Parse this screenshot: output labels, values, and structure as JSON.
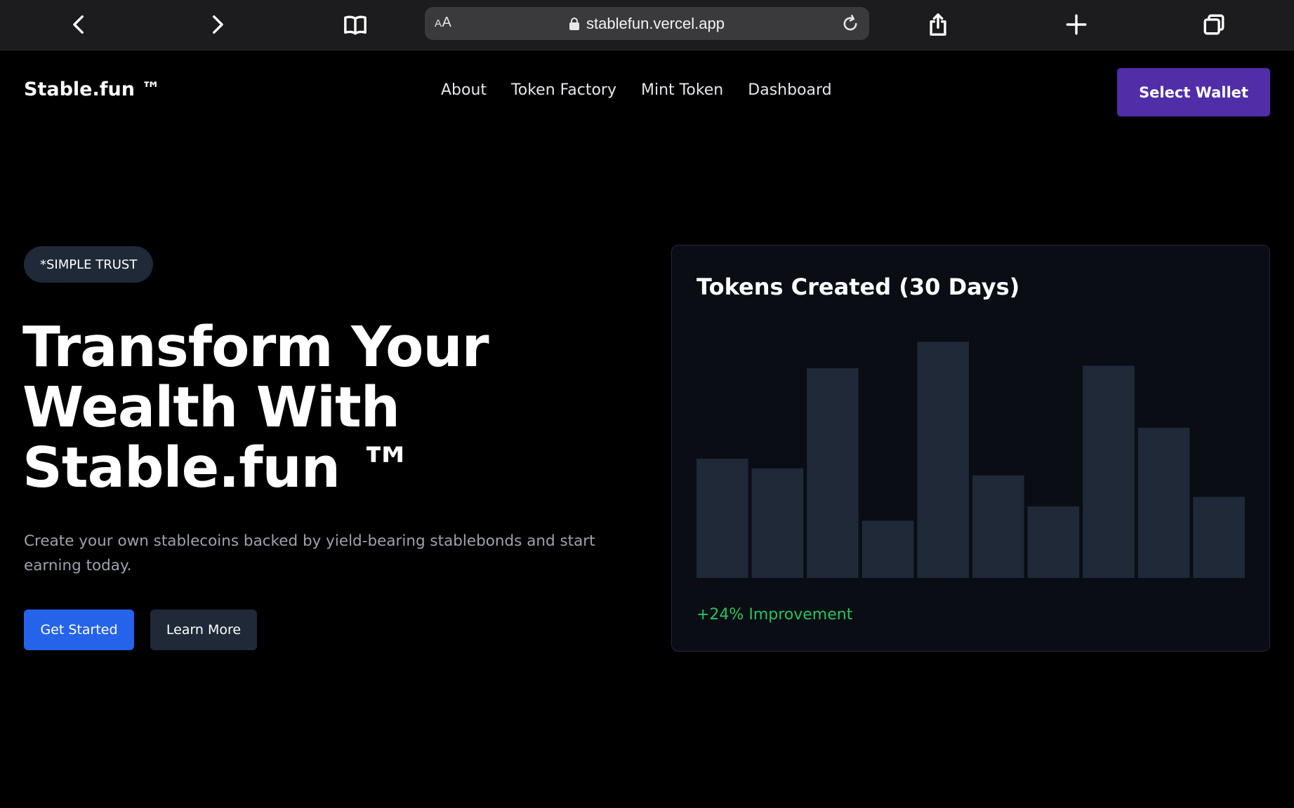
{
  "browser": {
    "url": "stablefun.vercel.app",
    "reader_label_small": "A",
    "reader_label_large": "A"
  },
  "site": {
    "logo": "Stable.fun ™",
    "nav": [
      "About",
      "Token Factory",
      "Mint Token",
      "Dashboard"
    ],
    "wallet_button": "Select Wallet"
  },
  "hero": {
    "badge": "*SIMPLE TRUST",
    "title_lines": [
      "Transform Your",
      "Wealth With",
      "Stable.fun ™"
    ],
    "description": "Create your own stablecoins backed by yield-bearing stablebonds and start earning today.",
    "primary_button": "Get Started",
    "secondary_button": "Learn More"
  },
  "chart_card": {
    "title": "Tokens Created (30 Days)",
    "footer": "+24% Improvement"
  },
  "chart_data": {
    "type": "bar",
    "title": "Tokens Created (30 Days)",
    "categories": [],
    "values": [
      50,
      46,
      88,
      24,
      99,
      43,
      30,
      89,
      63,
      34
    ],
    "ylim": [
      0,
      110
    ],
    "grid": false,
    "bar_color": "#1f2937"
  },
  "colors": {
    "accent_purple": "#512da8",
    "primary_blue": "#2563eb",
    "positive_green": "#22c55e"
  }
}
